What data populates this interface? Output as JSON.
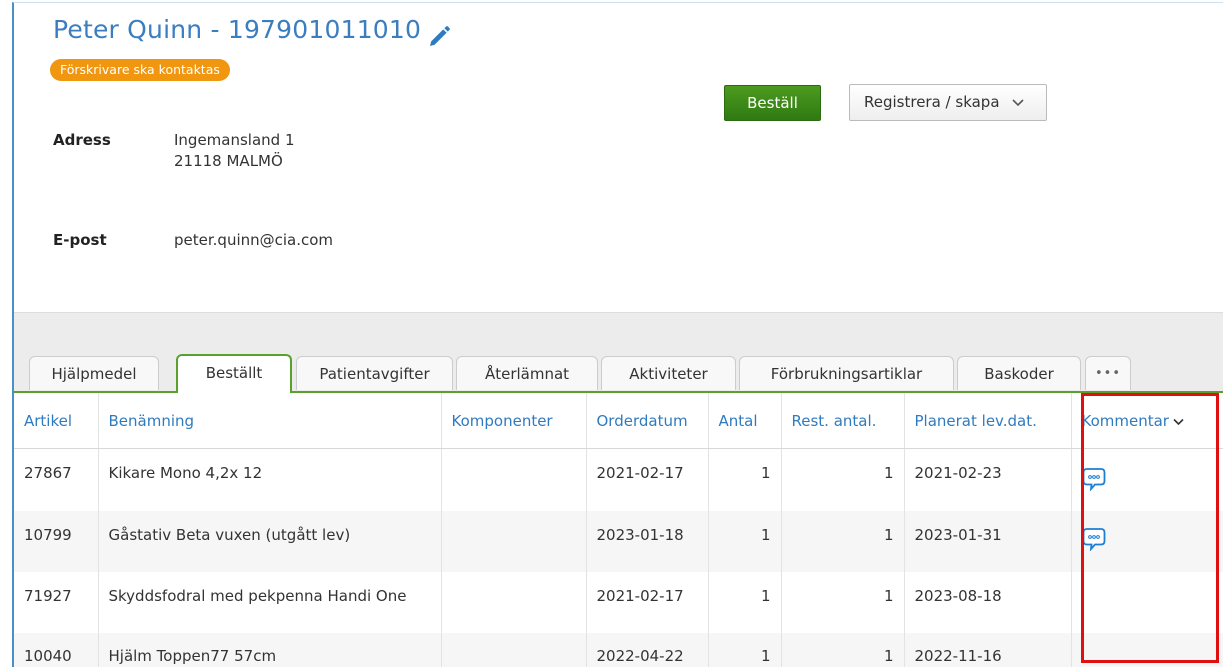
{
  "patient": {
    "title": "Peter Quinn - 197901011010",
    "badge": "Förskrivare ska kontaktas",
    "address_label": "Adress",
    "address_line1": "Ingemansland 1",
    "address_line2": "21118 MALMÖ",
    "email_label": "E-post",
    "email": "peter.quinn@cia.com"
  },
  "actions": {
    "order_label": "Beställ",
    "register_label": "Registrera / skapa"
  },
  "tabs": [
    {
      "label": "Hjälpmedel",
      "active": false
    },
    {
      "label": "Beställt",
      "active": true
    },
    {
      "label": "Patientavgifter",
      "active": false
    },
    {
      "label": "Återlämnat",
      "active": false
    },
    {
      "label": "Aktiviteter",
      "active": false
    },
    {
      "label": "Förbrukningsartiklar",
      "active": false
    },
    {
      "label": "Baskoder",
      "active": false
    },
    {
      "label": "•••",
      "active": false
    }
  ],
  "table": {
    "columns": [
      "Artikel",
      "Benämning",
      "Komponenter",
      "Orderdatum",
      "Antal",
      "Rest. antal.",
      "Planerat lev.dat.",
      "Kommentar"
    ],
    "rows": [
      {
        "artikel": "27867",
        "benamning": "Kikare Mono 4,2x 12",
        "komponenter": "",
        "orderdatum": "2021-02-17",
        "antal": "1",
        "rest": "1",
        "planerat": "2021-02-23",
        "has_comment": true
      },
      {
        "artikel": "10799",
        "benamning": "Gåstativ Beta vuxen (utgått lev)",
        "komponenter": "",
        "orderdatum": "2023-01-18",
        "antal": "1",
        "rest": "1",
        "planerat": "2023-01-31",
        "has_comment": true
      },
      {
        "artikel": "71927",
        "benamning": "Skyddsfodral med pekpenna Handi One",
        "komponenter": "",
        "orderdatum": "2021-02-17",
        "antal": "1",
        "rest": "1",
        "planerat": "2023-08-18",
        "has_comment": false
      },
      {
        "artikel": "10040",
        "benamning": "Hjälm Toppen77 57cm",
        "komponenter": "",
        "orderdatum": "2022-04-22",
        "antal": "1",
        "rest": "1",
        "planerat": "2022-11-16",
        "has_comment": false
      }
    ]
  },
  "colors": {
    "link_blue": "#2f7bbf",
    "accent_green": "#5aa02c",
    "badge_orange": "#f0960f",
    "highlight_red": "#e01010"
  },
  "icons": {
    "edit": "pencil-icon",
    "comment": "comment-bubble-icon",
    "dropdown": "chevron-down-icon"
  }
}
